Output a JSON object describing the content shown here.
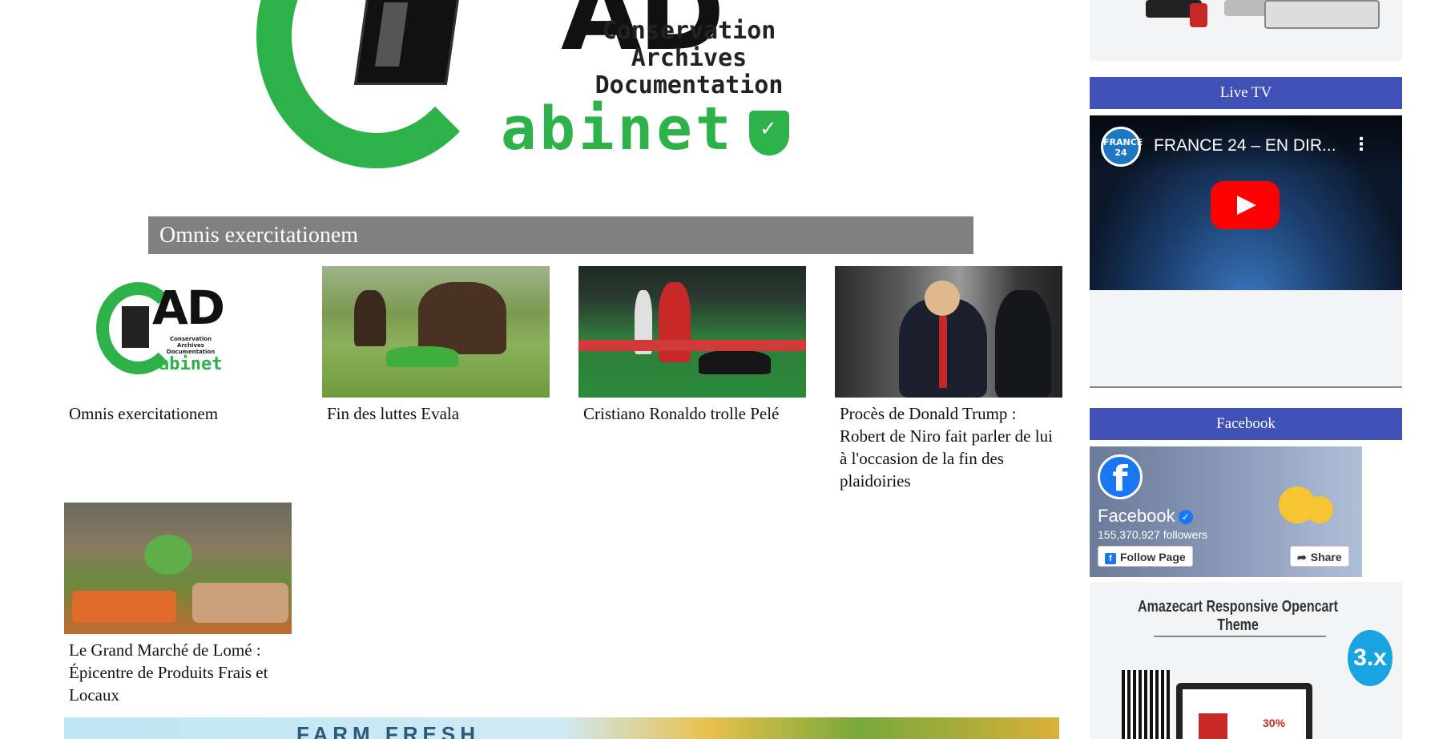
{
  "header": {
    "logo_lines": [
      "Conservation",
      "Archives",
      "Documentation"
    ],
    "logo_big": "AD",
    "logo_word": "abinet"
  },
  "section": {
    "title": "Omnis exercitationem"
  },
  "articles": [
    {
      "title": "Omnis exercitationem",
      "image": "cad-logo"
    },
    {
      "title": "Fin des luttes Evala",
      "image": "wrestling-photo"
    },
    {
      "title": "Cristiano Ronaldo trolle Pelé",
      "image": "football-photo"
    },
    {
      "title": "Procès de Donald Trump : Robert de Niro fait parler de lui à l'occasion de la fin des plaidoiries",
      "image": "trump-photo"
    },
    {
      "title": "Le Grand Marché de Lomé : Épicentre de Produits Frais et Locaux",
      "image": "market-photo"
    }
  ],
  "mini_logo": {
    "big": "AD",
    "sub": [
      "Conservation",
      "Archives",
      "Documentation"
    ],
    "word": "abinet"
  },
  "banner": {
    "text": "FARM FRESH"
  },
  "sidebar": {
    "live_tv": {
      "heading": "Live TV",
      "video_title": "FRANCE 24 – EN DIR...",
      "channel_badge": "FRANCE 24"
    },
    "facebook": {
      "heading": "Facebook",
      "page_name": "Facebook",
      "followers": "155,370,927 followers",
      "follow_label": "Follow Page",
      "share_label": "Share"
    },
    "ad": {
      "title": "Amazecart Responsive Opencart Theme",
      "badge": "3.x",
      "promo": "30%"
    }
  },
  "colors": {
    "brand_green": "#2db24a",
    "widget_blue": "#3f51b5",
    "section_gray": "#808080",
    "facebook_blue": "#1877f2"
  }
}
